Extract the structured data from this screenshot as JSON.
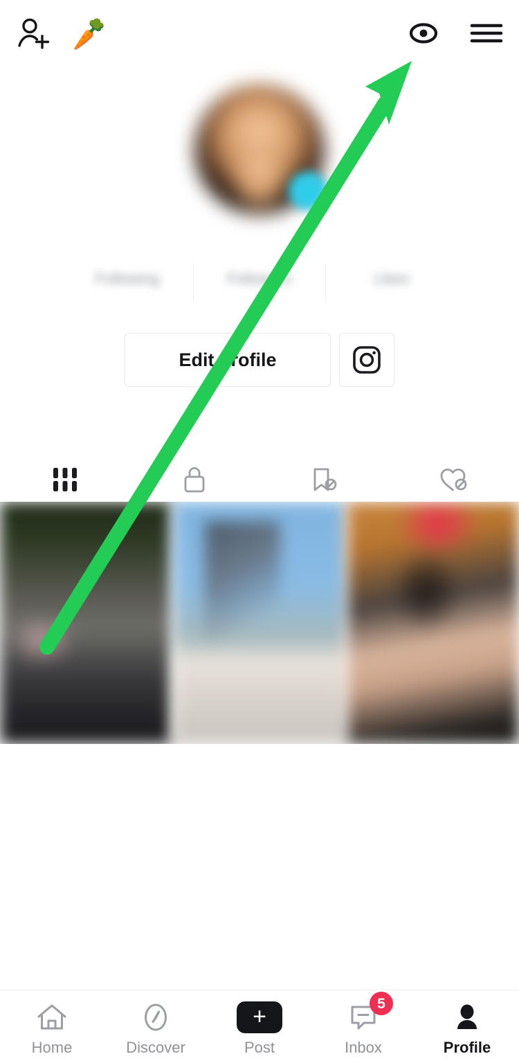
{
  "header": {
    "title": "",
    "add_user_icon": "add-user-icon",
    "carrot_emoji": "🥕",
    "eye_icon": "eye-icon",
    "menu_icon": "hamburger-menu-icon"
  },
  "profile": {
    "handle": "",
    "avatar_badge_icon": "verified-badge",
    "bio": "",
    "stats": [
      {
        "value": "",
        "label": "Following"
      },
      {
        "value": "",
        "label": "Followers"
      },
      {
        "value": "",
        "label": "Likes"
      }
    ],
    "edit_profile_label": "Edit profile",
    "instagram_icon": "instagram-icon"
  },
  "content_tabs": [
    {
      "name": "grid-tab",
      "icon": "grid-icon",
      "active": true
    },
    {
      "name": "private-tab",
      "icon": "lock-icon",
      "active": false
    },
    {
      "name": "saved-tab",
      "icon": "bookmark-slash-icon",
      "active": false
    },
    {
      "name": "liked-tab",
      "icon": "heart-slash-icon",
      "active": false
    }
  ],
  "grid": {
    "cells": [
      {
        "name": "video-thumbnail-1"
      },
      {
        "name": "video-thumbnail-2"
      },
      {
        "name": "video-thumbnail-3"
      }
    ]
  },
  "annotation": {
    "arrow_color": "#22cc55",
    "arrow_from": "68,935",
    "arrow_to": "595,88",
    "points_at": "eye-icon"
  },
  "bottom_nav": {
    "items": [
      {
        "label": "Home",
        "icon": "home-icon",
        "active": false,
        "badge": ""
      },
      {
        "label": "Discover",
        "icon": "compass-icon",
        "active": false,
        "badge": ""
      },
      {
        "label": "Post",
        "icon": "plus-icon",
        "active": false,
        "badge": ""
      },
      {
        "label": "Inbox",
        "icon": "inbox-icon",
        "active": false,
        "badge": "5"
      },
      {
        "label": "Profile",
        "icon": "person-icon",
        "active": true,
        "badge": ""
      }
    ]
  },
  "colors": {
    "accent_green": "#22cc55",
    "tiktok_cyan": "#31d6e8",
    "tiktok_pink": "#f5316a",
    "badge_red": "#f02e52",
    "text_dark": "#15161a",
    "text_muted": "#8e9298"
  }
}
